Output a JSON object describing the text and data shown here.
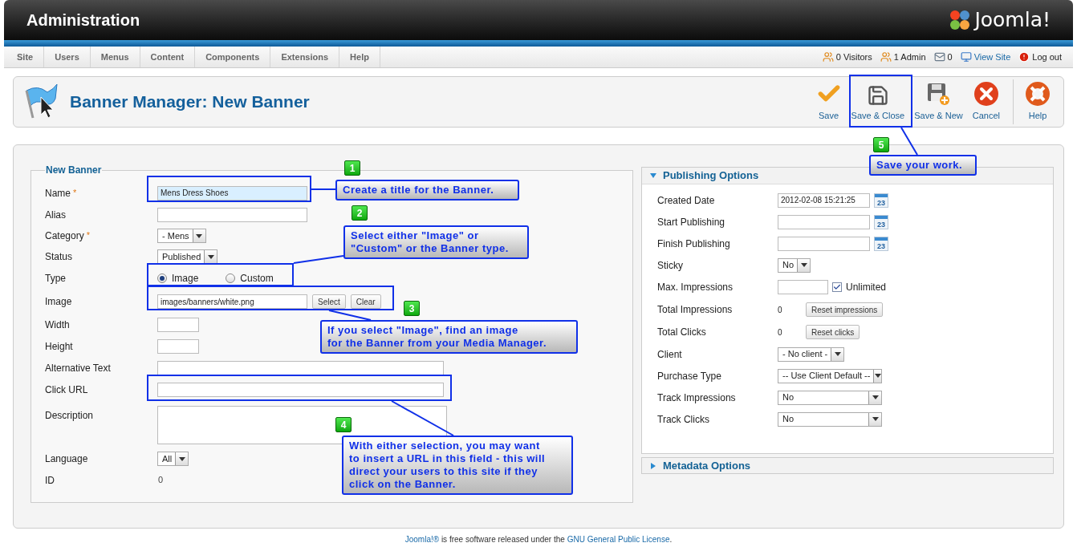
{
  "header": {
    "title": "Administration",
    "logo_text": "Joomla!"
  },
  "menu": [
    "Site",
    "Users",
    "Menus",
    "Content",
    "Components",
    "Extensions",
    "Help"
  ],
  "status": [
    {
      "kind": "visitors",
      "text": "0 Visitors"
    },
    {
      "kind": "admins",
      "text": "1 Admin"
    },
    {
      "kind": "messages",
      "text": "0"
    },
    {
      "kind": "view",
      "text": "View Site"
    },
    {
      "kind": "logout",
      "text": "Log out"
    }
  ],
  "toolbar": {
    "title": "Banner Manager: New Banner",
    "buttons": [
      {
        "kind": "save",
        "label": "Save"
      },
      {
        "kind": "save_close",
        "label": "Save & Close"
      },
      {
        "kind": "save_new",
        "label": "Save & New"
      },
      {
        "kind": "cancel",
        "label": "Cancel"
      },
      {
        "kind": "help",
        "label": "Help"
      }
    ]
  },
  "form": {
    "legend": "New Banner",
    "fields": [
      {
        "kind": "text",
        "label": "Name",
        "required_mark": "*",
        "value": "Mens Dress Shoes",
        "focused": true
      },
      {
        "kind": "text",
        "label": "Alias",
        "focused": false
      },
      {
        "kind": "select",
        "label": "Category",
        "required_mark": "*",
        "value": "- Mens"
      },
      {
        "kind": "select",
        "label": "Status",
        "value": "Published"
      },
      {
        "kind": "radio",
        "label": "Type",
        "options": [
          {
            "label": "Image",
            "selected": true
          },
          {
            "label": "Custom",
            "selected": false
          }
        ]
      },
      {
        "kind": "image",
        "label": "Image",
        "value": "images/banners/white.png",
        "buttons": [
          "Select",
          "Clear"
        ]
      },
      {
        "kind": "short",
        "label": "Width"
      },
      {
        "kind": "short",
        "label": "Height"
      },
      {
        "kind": "long",
        "label": "Alternative Text"
      },
      {
        "kind": "long",
        "label": "Click URL"
      },
      {
        "kind": "textarea",
        "label": "Description"
      },
      {
        "kind": "select",
        "label": "Language",
        "value": "All"
      },
      {
        "kind": "static",
        "label": "ID",
        "value": "0"
      }
    ]
  },
  "publishing": {
    "title": "Publishing Options",
    "expanded": true,
    "rows": [
      {
        "kind": "date",
        "label": "Created Date",
        "value": "2012-02-08 15:21:25",
        "icon_text": "23"
      },
      {
        "kind": "date",
        "label": "Start Publishing",
        "icon_text": "23"
      },
      {
        "kind": "date",
        "label": "Finish Publishing",
        "icon_text": "23"
      },
      {
        "kind": "select",
        "label": "Sticky",
        "value": "No"
      },
      {
        "kind": "limit",
        "label": "Max. Impressions",
        "check_label": "Unlimited",
        "checked": true
      },
      {
        "kind": "counter",
        "label": "Total Impressions",
        "value": "0",
        "button": "Reset impressions"
      },
      {
        "kind": "counter",
        "label": "Total Clicks",
        "value": "0",
        "button": "Reset clicks"
      },
      {
        "kind": "select",
        "label": "Client",
        "value": "- No client -"
      },
      {
        "kind": "wide_select",
        "label": "Purchase Type",
        "value": "-- Use Client Default --"
      },
      {
        "kind": "wide_select",
        "label": "Track Impressions",
        "value": "No"
      },
      {
        "kind": "wide_select",
        "label": "Track Clicks",
        "value": "No"
      }
    ]
  },
  "metadata": {
    "title": "Metadata Options",
    "expanded": false
  },
  "annotations": [
    {
      "number": "1",
      "text": "Create a title for the Banner."
    },
    {
      "number": "2",
      "text": "Select either \"Image\" or\n\"Custom\" or the Banner type."
    },
    {
      "number": "3",
      "text": "If you select \"Image\", find an image\nfor the Banner from your Media Manager."
    },
    {
      "number": "4",
      "text": "With either selection, you may want\nto insert a URL in this field - this will\ndirect your users to this site if they\nclick on the Banner."
    },
    {
      "number": "5",
      "text": "Save your work."
    }
  ],
  "footer": [
    {
      "text": "Joomla!®",
      "link": true
    },
    {
      "text": " is free software released under the ",
      "link": false
    },
    {
      "text": "GNU General Public License",
      "link": true
    },
    {
      "text": ".",
      "link": false
    }
  ]
}
